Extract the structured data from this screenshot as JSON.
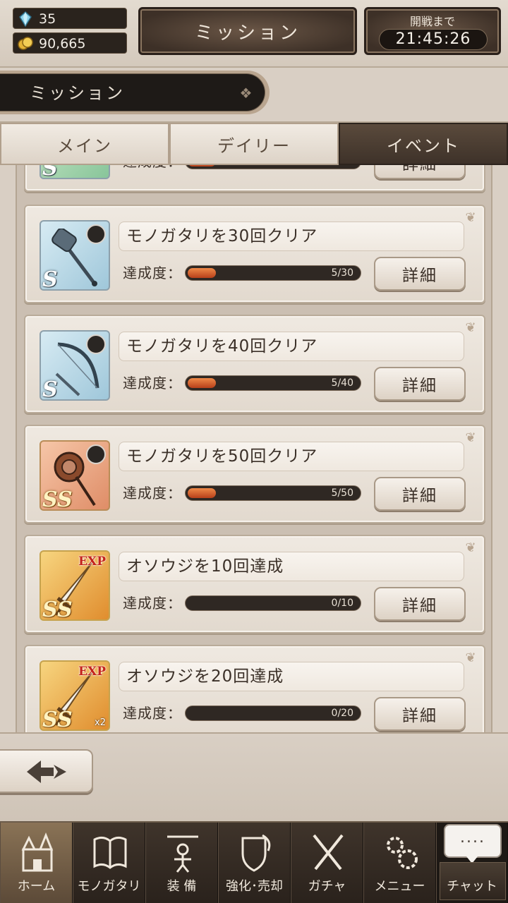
{
  "header": {
    "gems": "35",
    "coins": "90,665",
    "title": "ミッション",
    "timer_label": "開戦まで",
    "timer_value": "21:45:26"
  },
  "section": {
    "title": "ミッション"
  },
  "tabs": [
    {
      "label": "メイン",
      "active": false
    },
    {
      "label": "デイリー",
      "active": false
    },
    {
      "label": "イベント",
      "active": true
    }
  ],
  "missions": [
    {
      "name": "",
      "progress_label": "達成度：",
      "progress": "",
      "progress_fraction": 0.1,
      "detail": "詳細",
      "rarity": "S",
      "thumb": "green",
      "icon": "staff-weapon-icon"
    },
    {
      "name": "モノガタリを30回クリア",
      "progress_label": "達成度：",
      "progress": "5/30",
      "progress_fraction": 0.1667,
      "detail": "詳細",
      "rarity": "S",
      "thumb": "s",
      "icon": "hammer-weapon-icon"
    },
    {
      "name": "モノガタリを40回クリア",
      "progress_label": "達成度：",
      "progress": "5/40",
      "progress_fraction": 0.125,
      "detail": "詳細",
      "rarity": "S",
      "thumb": "s",
      "icon": "bow-weapon-icon"
    },
    {
      "name": "モノガタリを50回クリア",
      "progress_label": "達成度：",
      "progress": "5/50",
      "progress_fraction": 0.1,
      "detail": "詳細",
      "rarity": "SS",
      "thumb": "ss-orange",
      "icon": "flail-weapon-icon"
    },
    {
      "name": "オソウジを10回達成",
      "progress_label": "達成度：",
      "progress": "0/10",
      "progress_fraction": 0,
      "detail": "詳細",
      "rarity": "SS",
      "thumb": "ss-gold",
      "icon": "exp-sword-icon",
      "tag": "EXP"
    },
    {
      "name": "オソウジを20回達成",
      "progress_label": "達成度：",
      "progress": "0/20",
      "progress_fraction": 0,
      "detail": "詳細",
      "rarity": "SS",
      "thumb": "ss-gold",
      "icon": "exp-sword-icon",
      "tag": "EXP",
      "multiplier": "x2"
    }
  ],
  "nav": [
    {
      "label": "ホーム",
      "icon": "castle-icon",
      "active": true
    },
    {
      "label": "モノガタリ",
      "icon": "book-icon",
      "active": false
    },
    {
      "label": "装 備",
      "icon": "marionette-icon",
      "active": false
    },
    {
      "label": "強化･売却",
      "icon": "shield-icon",
      "active": false
    },
    {
      "label": "ガチャ",
      "icon": "crossed-swords-icon",
      "active": false
    },
    {
      "label": "メニュー",
      "icon": "gears-icon",
      "active": false
    }
  ],
  "chat": {
    "bubble": "....",
    "label": "チャット"
  },
  "colors": {
    "accent": "#3e3229",
    "progress": "#e06a2a",
    "panel": "#efe9e1"
  }
}
